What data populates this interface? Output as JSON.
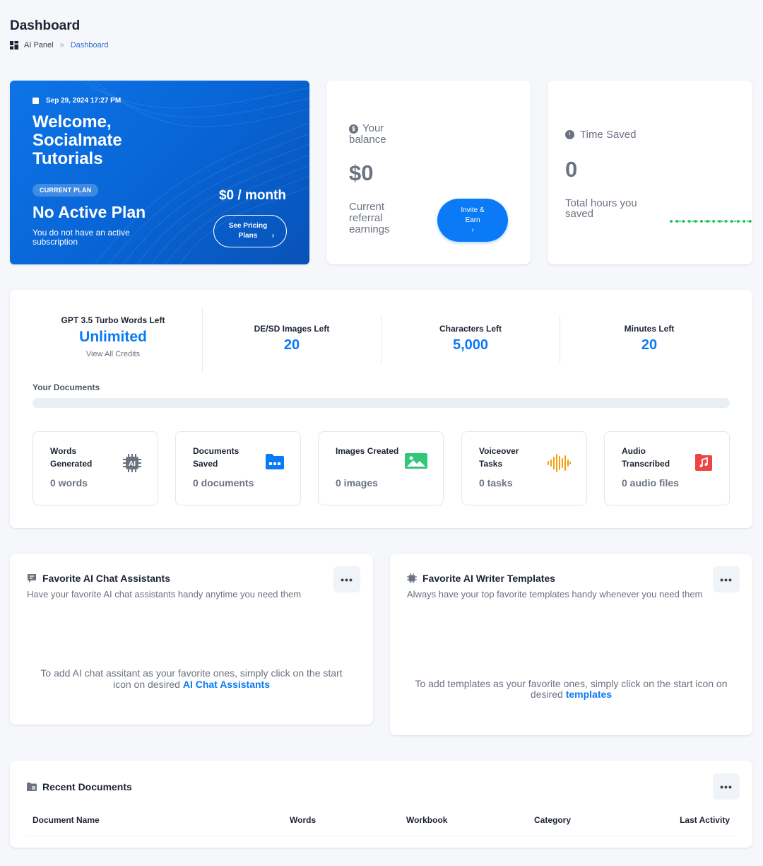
{
  "header": {
    "title": "Dashboard",
    "breadcrumb": {
      "root": "AI Panel",
      "separator": "»",
      "current": "Dashboard"
    }
  },
  "welcome": {
    "date": "Sep 29, 2024 17:27 PM",
    "greeting": "Welcome, Socialmate Tutorials",
    "plan_badge": "CURRENT PLAN",
    "plan_name": "No Active Plan",
    "plan_desc": "You do not have an active subscription",
    "price": "$0 / month",
    "pricing_button": "See Pricing Plans"
  },
  "balance": {
    "label": "Your balance",
    "amount": "$0",
    "sub_label": "Current referral earnings",
    "invite_button": "Invite & Earn"
  },
  "time_saved": {
    "label": "Time Saved",
    "value": "0",
    "sub_label": "Total hours you saved"
  },
  "credits": {
    "items": [
      {
        "label": "GPT 3.5 Turbo Words Left",
        "value": "Unlimited",
        "link": "View All Credits"
      },
      {
        "label": "DE/SD Images Left",
        "value": "20"
      },
      {
        "label": "Characters Left",
        "value": "5,000"
      },
      {
        "label": "Minutes Left",
        "value": "20"
      }
    ],
    "documents_label": "Your Documents",
    "documents_progress": 0
  },
  "stats": [
    {
      "title": "Words Generated",
      "value": "0 words",
      "icon": "ai-chip-icon"
    },
    {
      "title": "Documents Saved",
      "value": "0 documents",
      "icon": "folder-icon"
    },
    {
      "title": "Images Created",
      "value": "0 images",
      "icon": "image-icon"
    },
    {
      "title": "Voiceover Tasks",
      "value": "0 tasks",
      "icon": "soundwave-icon"
    },
    {
      "title": "Audio Transcribed",
      "value": "0 audio files",
      "icon": "music-note-icon"
    }
  ],
  "favorites": {
    "chat": {
      "title": "Favorite AI Chat Assistants",
      "subtitle": "Have your favorite AI chat assistants handy anytime you need them",
      "empty_text": "To add AI chat assitant as your favorite ones, simply click on the start icon on desired",
      "empty_link": "AI Chat Assistants",
      "menu": "•••"
    },
    "templates": {
      "title": "Favorite AI Writer Templates",
      "subtitle": "Always have your top favorite templates handy whenever you need them",
      "empty_text": "To add templates as your favorite ones, simply click on the start icon on desired",
      "empty_link": "templates",
      "menu": "•••"
    }
  },
  "recent": {
    "title": "Recent Documents",
    "menu": "•••",
    "columns": [
      "Document Name",
      "Words",
      "Workbook",
      "Category",
      "Last Activity"
    ]
  },
  "colors": {
    "accent": "#0a7af6",
    "welcome_gradient_start": "#0d74e8",
    "welcome_gradient_end": "#0852b8",
    "time_saved_line": "#22c55e"
  }
}
